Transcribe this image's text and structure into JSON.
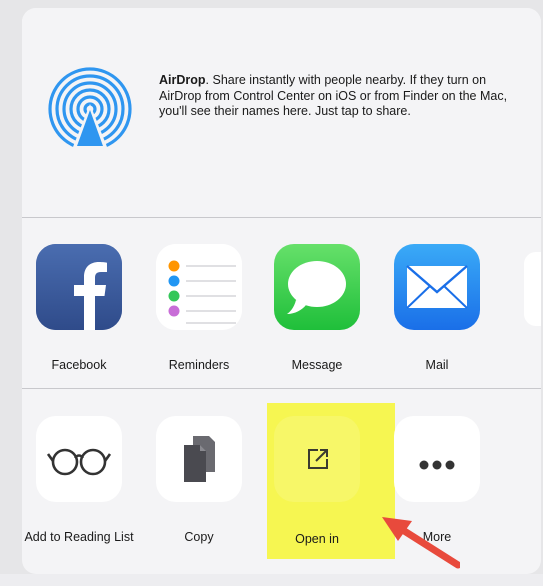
{
  "airdrop": {
    "title": "AirDrop",
    "description": ". Share instantly with people nearby. If they turn on AirDrop from Control Center on iOS or from Finder on the Mac, you'll see their names here. Just tap to share.",
    "icon": "airdrop-icon"
  },
  "apps": [
    {
      "label": "Facebook",
      "icon": "facebook-icon",
      "color": "#3b5998"
    },
    {
      "label": "Reminders",
      "icon": "reminders-icon",
      "color": "#ffffff"
    },
    {
      "label": "Message",
      "icon": "message-icon",
      "color": "#34c759"
    },
    {
      "label": "Mail",
      "icon": "mail-icon",
      "color": "#1e88f5"
    }
  ],
  "actions": [
    {
      "label": "Add to Reading List",
      "icon": "glasses-icon"
    },
    {
      "label": "Copy",
      "icon": "copy-icon"
    },
    {
      "label": "Open in",
      "icon": "open-in-icon"
    },
    {
      "label": "More",
      "icon": "more-icon"
    }
  ],
  "colors": {
    "highlight": "#f5f542",
    "arrow": "#e84a3c",
    "accent": "#1e88f5"
  }
}
